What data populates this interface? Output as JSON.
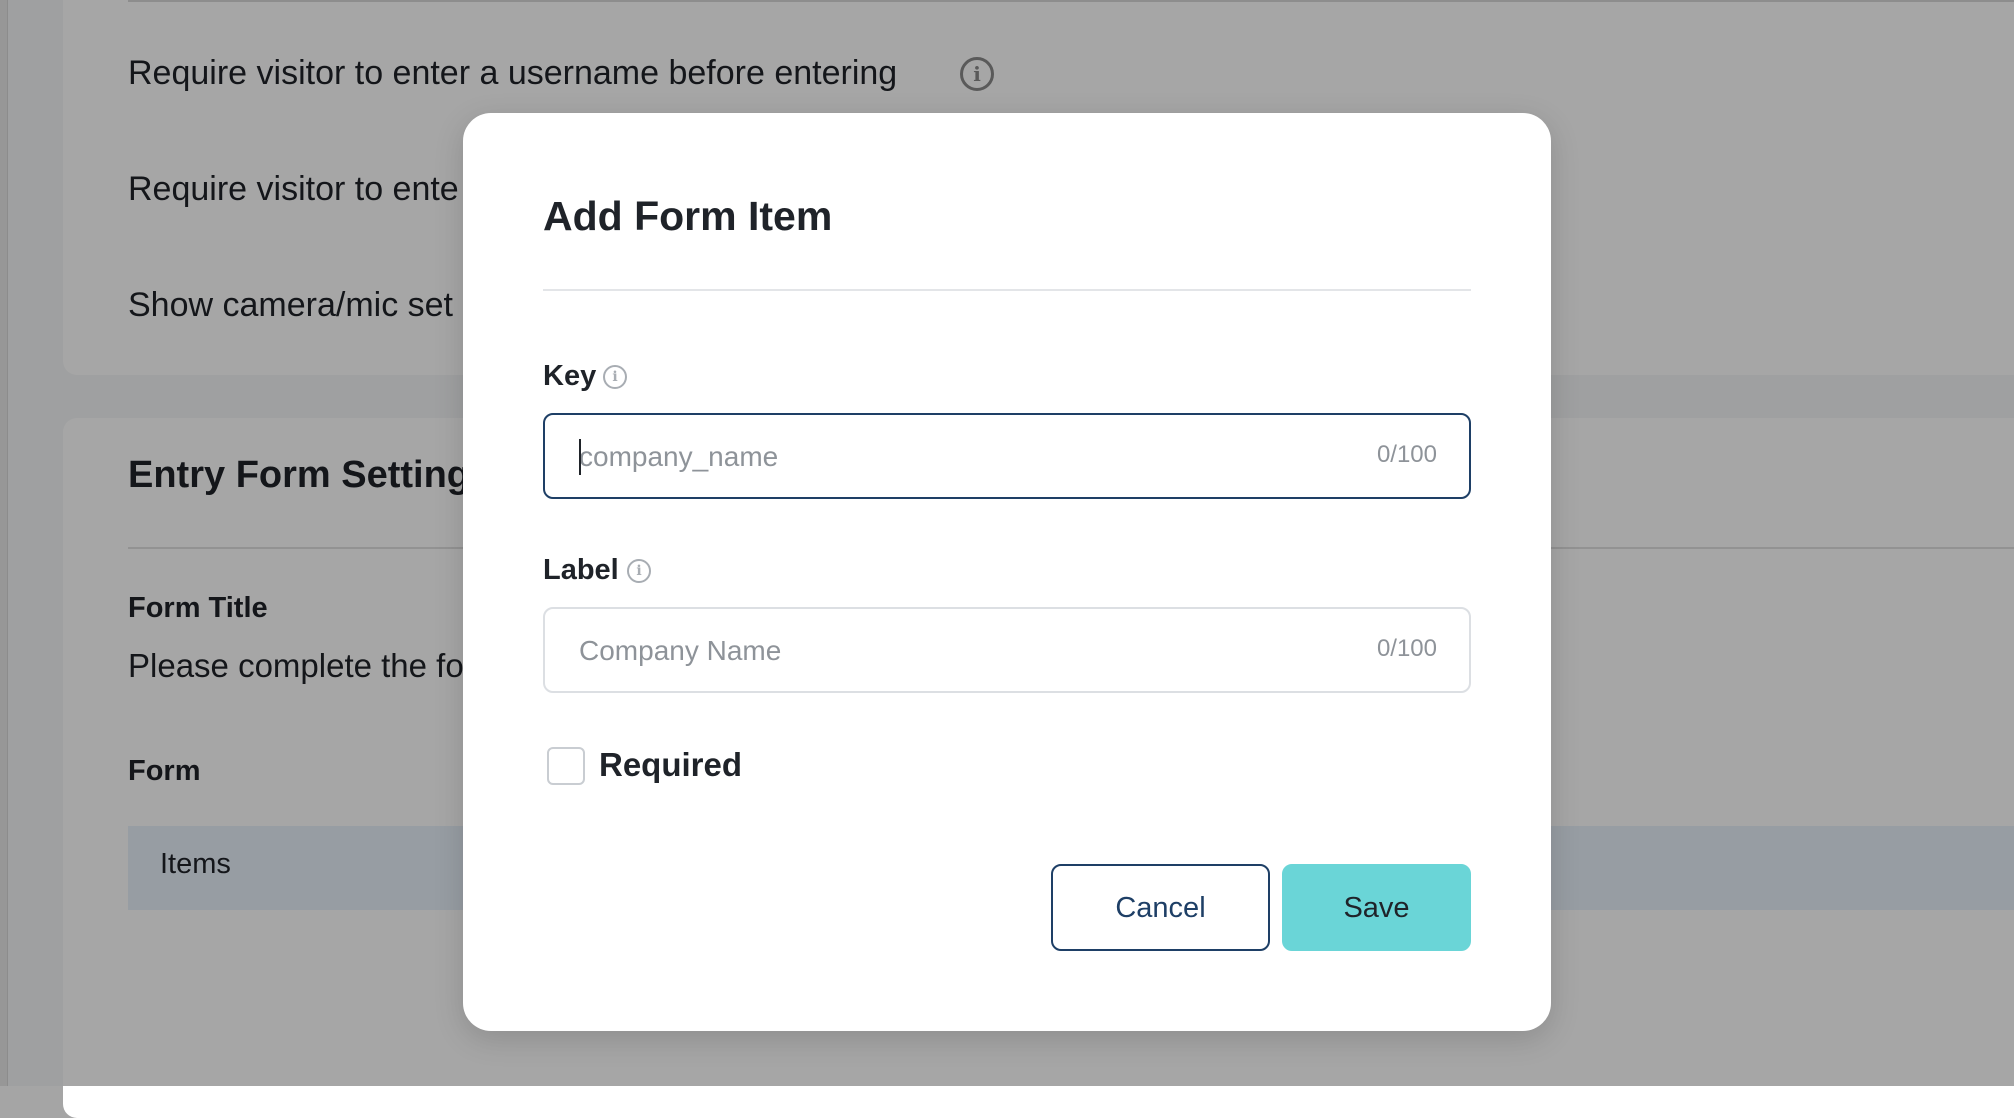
{
  "background": {
    "settings": [
      "Require visitor to enter a username before entering",
      "Require visitor to ente",
      "Show camera/mic set"
    ],
    "section_title": "Entry Form Settings",
    "form_title_label": "Form Title",
    "form_title_value": "Please complete the fo",
    "form_label": "Form",
    "items_header": "Items",
    "info_icon_glyph": "i"
  },
  "modal": {
    "title": "Add Form Item",
    "key": {
      "label": "Key",
      "placeholder": "company_name",
      "value": "",
      "counter": "0/100"
    },
    "label_field": {
      "label": "Label",
      "placeholder": "Company Name",
      "value": "",
      "counter": "0/100"
    },
    "required": {
      "label": "Required",
      "checked": false
    },
    "buttons": {
      "cancel": "Cancel",
      "save": "Save"
    },
    "info_icon_glyph": "i"
  },
  "colors": {
    "primary": "#1e3f66",
    "accent": "#6ad5d7",
    "overlay": "rgba(0,0,0,0.35)"
  },
  "icons": [
    "info-icon",
    "checkbox-unchecked"
  ]
}
